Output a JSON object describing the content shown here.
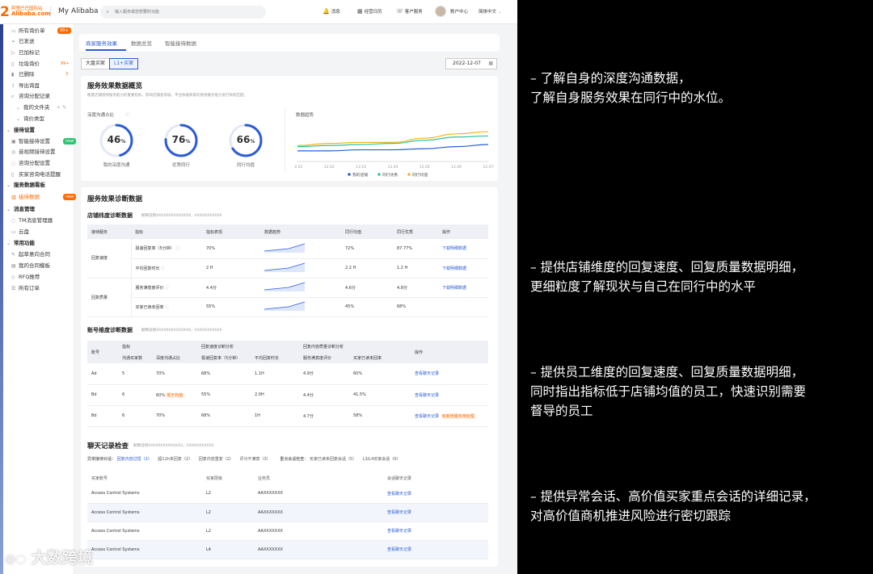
{
  "header": {
    "logo_line1": "阿里巴巴国际站",
    "logo_line2": "Alibaba.com",
    "logo_mark": "2",
    "brand": "My Alibaba",
    "search_placeholder": "输入服务或您想要的功能",
    "nav": [
      "消息",
      "经营日历",
      "客户服务",
      "账户中心",
      "简体中文"
    ]
  },
  "sidebar": {
    "items": [
      {
        "label": "所有询价单",
        "badge": "99+"
      },
      {
        "label": "已发送"
      },
      {
        "label": "已加标记"
      },
      {
        "label": "垃圾询价",
        "badge": "99+"
      },
      {
        "label": "已删除",
        "badge": "3"
      },
      {
        "label": "导出询盘"
      },
      {
        "label": "咨询分配记录"
      },
      {
        "label": "我的文件夹"
      },
      {
        "label": "询价类型"
      },
      {
        "label": "接待设置",
        "head": true
      },
      {
        "label": "智能接待设置",
        "badge": "new"
      },
      {
        "label": "音视频接待设置"
      },
      {
        "label": "咨询分配设置"
      },
      {
        "label": "买家咨询电话提醒"
      },
      {
        "label": "服务数据看板",
        "head": true
      },
      {
        "label": "接待数据",
        "active": true,
        "badge": "new"
      },
      {
        "label": "消息管理",
        "head": true
      },
      {
        "label": "TM消息管理器"
      },
      {
        "label": "云盘"
      },
      {
        "label": "常用功能",
        "head": true
      },
      {
        "label": "起草意向合同"
      },
      {
        "label": "我的合同模板"
      },
      {
        "label": "RFQ推荐"
      },
      {
        "label": "所有订单"
      }
    ]
  },
  "tabs": [
    "商家服务效果",
    "数据总览",
    "智能接待数据"
  ],
  "filters": {
    "b1": "大盘买家",
    "b2": "L1+买家",
    "date": "2022-12-07"
  },
  "overview": {
    "title": "服务效果数据概览",
    "desc": "衡量店铺接待服务能力的重要指标，影响店铺星等级。平台依据商家的接待服务能力进行商机匹配。",
    "depth_label": "深度沟通占比",
    "trend_label": "数据趋势",
    "rings": [
      {
        "value": "46",
        "unit": "%",
        "label": "我的深度沟通"
      },
      {
        "value": "76",
        "unit": "%",
        "label": "优秀同行"
      },
      {
        "value": "66",
        "unit": "%",
        "label": "同行均值"
      }
    ]
  },
  "chart_data": {
    "type": "line",
    "categories": [
      "12.01",
      "12.02",
      "12.03",
      "12.04",
      "12.05",
      "12.06",
      "12.07"
    ],
    "series": [
      {
        "name": "我的店铺",
        "color": "#2a5bd7",
        "values": [
          40,
          40,
          41,
          41,
          42,
          44,
          46
        ]
      },
      {
        "name": "同行优秀",
        "color": "#2ec4a0",
        "values": [
          44,
          45,
          46,
          47,
          50,
          53,
          54
        ]
      },
      {
        "name": "同行均值",
        "color": "#f2b51f",
        "values": [
          45,
          47,
          48,
          48,
          52,
          56,
          58
        ]
      }
    ],
    "ylim": [
      30,
      65
    ],
    "grid": false,
    "legend": "bottom"
  },
  "diagnosis": {
    "title": "服务效果诊断数据",
    "shop_title": "店铺纬度诊断数据",
    "shop_desc": "解释说明XXXXXXXXXXXXXX，XXXXXXXXXXX",
    "shop_headers": [
      "接待服务",
      "指标",
      "指标表现",
      "数据趋势",
      "同行均值",
      "同行优秀",
      "操作"
    ],
    "shop_rows": [
      {
        "group": "回复速度",
        "metric": "极速回复率（5分钟）",
        "value": "70%",
        "avg": "72%",
        "best": "87.77%",
        "op": "下载明细数据"
      },
      {
        "group": "",
        "metric": "平均回复时长",
        "value": "2 H",
        "avg": "2.2 H",
        "best": "1.2 H",
        "op": "下载明细数据"
      },
      {
        "group": "回复质量",
        "metric": "服务满意度评价",
        "value": "4.4分",
        "avg": "4.6分",
        "best": "4.8分",
        "op": "下载明细数据"
      },
      {
        "group": "",
        "metric": "买家已读未回率",
        "value": "55%",
        "avg": "45%",
        "best": "68%",
        "op": ""
      }
    ],
    "acct_title": "账号维度诊断数据",
    "acct_desc": "解释说明XXXXXXXXXXXXXX，XXXXXXXXXXX",
    "acct_groups": [
      "指标",
      "回复速度诊断分析",
      "回复内容质量诊断分析"
    ],
    "acct_headers": [
      "账号",
      "沟通买家数",
      "深度沟通占比",
      "极速回复率（5分钟）",
      "平均回复时长",
      "服务满意度评价",
      "买家已读未回率",
      "操作"
    ],
    "acct_rows": [
      {
        "a": "Ad",
        "n": "5",
        "d": "70%",
        "r": "68%",
        "t": "1.1H",
        "s": "4.9分",
        "u": "60%",
        "op": "查看聊天记录",
        "tag": ""
      },
      {
        "a": "Bd",
        "n": "6",
        "d": "60%",
        "dtag": "低于均值",
        "r": "55%",
        "t": "2.0H",
        "s": "4.4分",
        "u": "41.5%",
        "op": "查看聊天记录",
        "tag": ""
      },
      {
        "a": "Bd",
        "n": "6",
        "d": "70%",
        "r": "68%",
        "t": "1H",
        "s": "4.7分",
        "u": "58%",
        "op": "查看聊天记录",
        "tag": "有新增服务待处理"
      }
    ]
  },
  "chat": {
    "title": "聊天记录检查",
    "desc": "解释说明XXXXXXXXXXXXXX，XXXXXXXXXXX",
    "f1": "异常接待对话：",
    "f1o": [
      "回复内容过短（2）",
      "超12h未回复（2）",
      "回复内容重复（2）",
      "评分不满意（3）"
    ],
    "f2": "重点会话检查：",
    "f2o": [
      "买家已读未回复会话（5）",
      "L3/L4买家会话（0）"
    ],
    "headers": [
      "买家账号",
      "买家层级",
      "业务员",
      "会话聊天记录"
    ],
    "rows": [
      {
        "b": "Access Control Systems",
        "l": "L2",
        "s": "AAXXXXXXX",
        "op": "查看聊天记录"
      },
      {
        "b": "Access Control Systems",
        "l": "L2",
        "s": "AAXXXXXXX",
        "op": "查看聊天记录"
      },
      {
        "b": "Access Control Systems",
        "l": "L2",
        "s": "AAXXXXXXX",
        "op": "查看聊天记录"
      },
      {
        "b": "Access Control Systems",
        "l": "L4",
        "s": "AAXXXXXXX",
        "op": "查看聊天记录"
      }
    ]
  },
  "captions": [
    "– 了解自身的深度沟通数据，",
    "了解自身服务效果在同行中的水位。",
    "– 提供店铺维度的回复速度、回复质量数据明细，",
    "更细粒度了解现状与自己在同行中的水平",
    "– 提供员工维度的回复速度、回复质量数据明细，",
    "同时指出指标低于店铺均值的员工，快速识别需要",
    "督导的员工",
    "– 提供异常会话、高价值买家重点会话的详细记录，",
    "对高价值商机推进风险进行密切跟踪"
  ],
  "watermark": "大数跨境"
}
